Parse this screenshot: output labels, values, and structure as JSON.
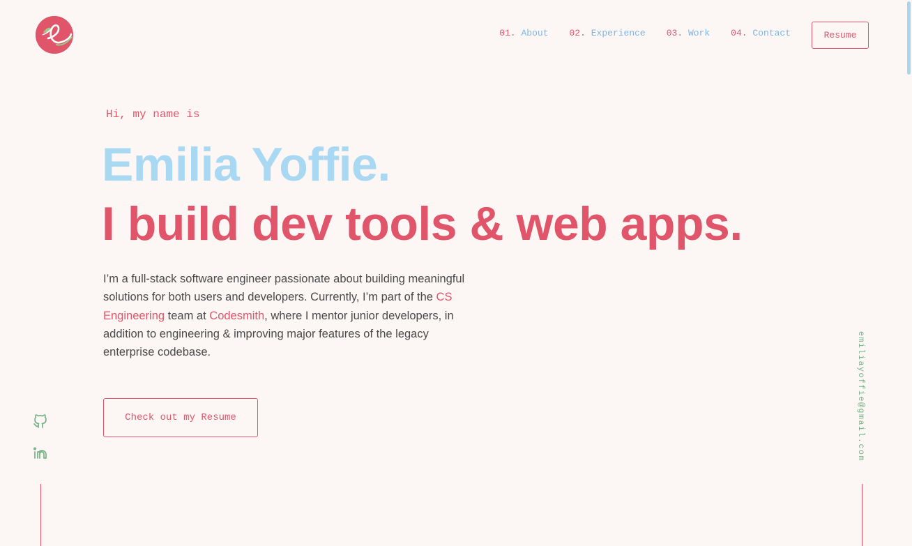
{
  "colors": {
    "background": "#fcf6f5",
    "accent": "#e05569",
    "name": "#a9d8f2",
    "nav_label": "#7fb6e0",
    "social": "#74b184",
    "body_text": "#4a4a4a"
  },
  "header": {
    "logo_icon": "apple-e-logo-icon",
    "nav": [
      {
        "num": "01.",
        "label": "About"
      },
      {
        "num": "02.",
        "label": "Experience"
      },
      {
        "num": "03.",
        "label": "Work"
      },
      {
        "num": "04.",
        "label": "Contact"
      }
    ],
    "resume_label": "Resume"
  },
  "hero": {
    "greeting": "Hi, my name is",
    "name": "Emilia Yoffie.",
    "tagline": "I build dev tools & web apps.",
    "intro": {
      "part1": "I’m a full-stack software engineer passionate about building meaningful solutions for both users and developers. Currently, I’m part of the ",
      "link1": "CS Engineering",
      "part2": " team at ",
      "link2": "Codesmith",
      "part3": ", where I mentor junior developers, in addition to engineering & improving major features of the legacy enterprise codebase."
    },
    "cta_label": "Check out my Resume"
  },
  "social": {
    "github_icon": "github-icon",
    "linkedin_icon": "linkedin-icon"
  },
  "email": "emiliayoffie@gmail.com"
}
